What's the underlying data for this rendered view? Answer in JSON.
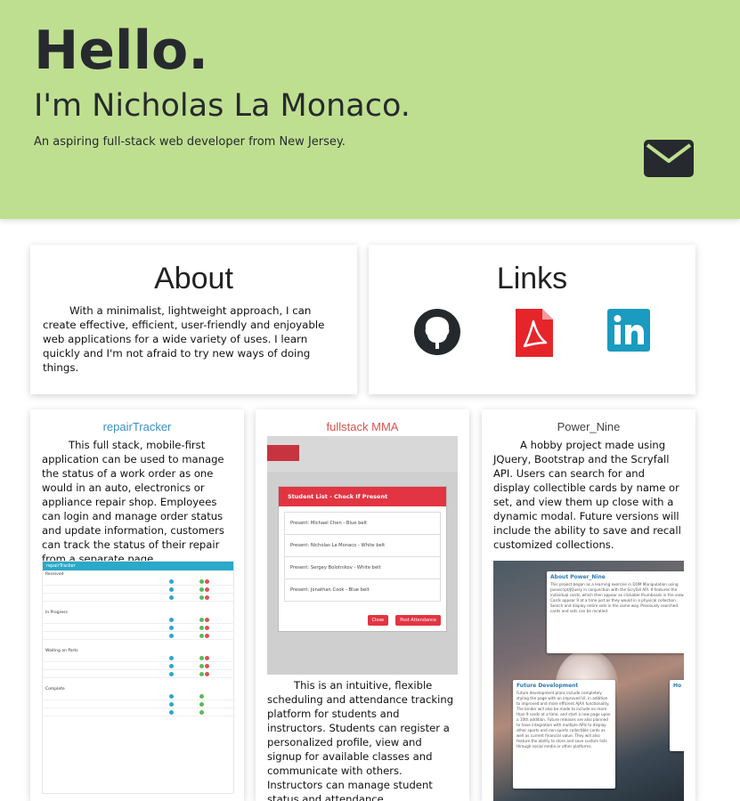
{
  "hero": {
    "greeting": "Hello.",
    "name": "I'm Nicholas La Monaco.",
    "tagline": "An aspiring full-stack web developer from New Jersey.",
    "contact_icon": "envelope-icon"
  },
  "about": {
    "title": "About",
    "text": "With a minimalist, lightweight approach, I can create effective, efficient, user-friendly and enjoyable web applications for a wide variety of uses. I learn quickly and I'm not afraid to try new ways of doing things."
  },
  "links": {
    "title": "Links",
    "items": [
      {
        "icon": "github-icon",
        "color": "#24292e"
      },
      {
        "icon": "pdf-resume-icon",
        "color": "#e5252a"
      },
      {
        "icon": "linkedin-icon",
        "color": "#1a9bbf"
      }
    ]
  },
  "projects": [
    {
      "title": "repairTracker",
      "title_color": "#3a8fc7",
      "description": "This full stack, mobile-first application can be used to manage the status of a work order as one would in an auto, electronics or appliance repair shop. Employees can login and manage order status and update information, customers can track the status of their repair from a separate page.",
      "screenshot": {
        "bar": "repairTracker",
        "sections": [
          "Received",
          "In Progress",
          "Waiting on Parts",
          "Complete"
        ]
      }
    },
    {
      "title": "fullstack MMA",
      "title_color": "#d9534f",
      "description": "This is an intuitive, flexible scheduling and attendance tracking platform for students and instructors. Students can register a personalized profile, view and signup for available classes and communicate with others. Instructors can manage student status and attendance.",
      "screenshot": {
        "modal_title": "Student List - Check If Present",
        "rows": [
          "Present: Michael Chen - Blue belt",
          "Present: Nicholas La Monaco - White belt",
          "Present: Sergey Bolotnikov - White belt",
          "Present: Jonathan Cook - Blue belt"
        ],
        "close_label": "Close",
        "post_label": "Post Attendance"
      }
    },
    {
      "title": "Power_Nine",
      "title_color": "#444444",
      "description": "A hobby project made using JQuery, Bootstrap and the Scryfall API. Users can search for and display collectible cards by name or set, and view them up close with a dynamic modal. Future versions will include the ability to save and recall customized collections.",
      "screenshot": {
        "about_heading": "About Power_Nine",
        "about_text": "This project began as a learning exercise in DOM Manipulation using Javascript/JQuery in conjunction with the Scryfall API. It features the individual cards, which then appear as clickable thumbnails in the view. Cards appear 9 at a time just as they would in a physical collection. Search and display entire sets in the same way. Previously searched cards and sets can be recalled.",
        "future_heading": "Future Development",
        "future_text": "Future development plans include completely styling the page with an improved UI, in addition to improved and more efficient AJAX functionality. The binder will also be made to include no more than 9 cards at a time, and start a new page upon a 10th addition. Future releases are also planned to have integration with multiple APIs to display other sports and non-sports collectible cards as well as current financial value. They will also feature the ability to store and save custom lists through social media or other platforms.",
        "side_heading": "Ho"
      }
    }
  ]
}
